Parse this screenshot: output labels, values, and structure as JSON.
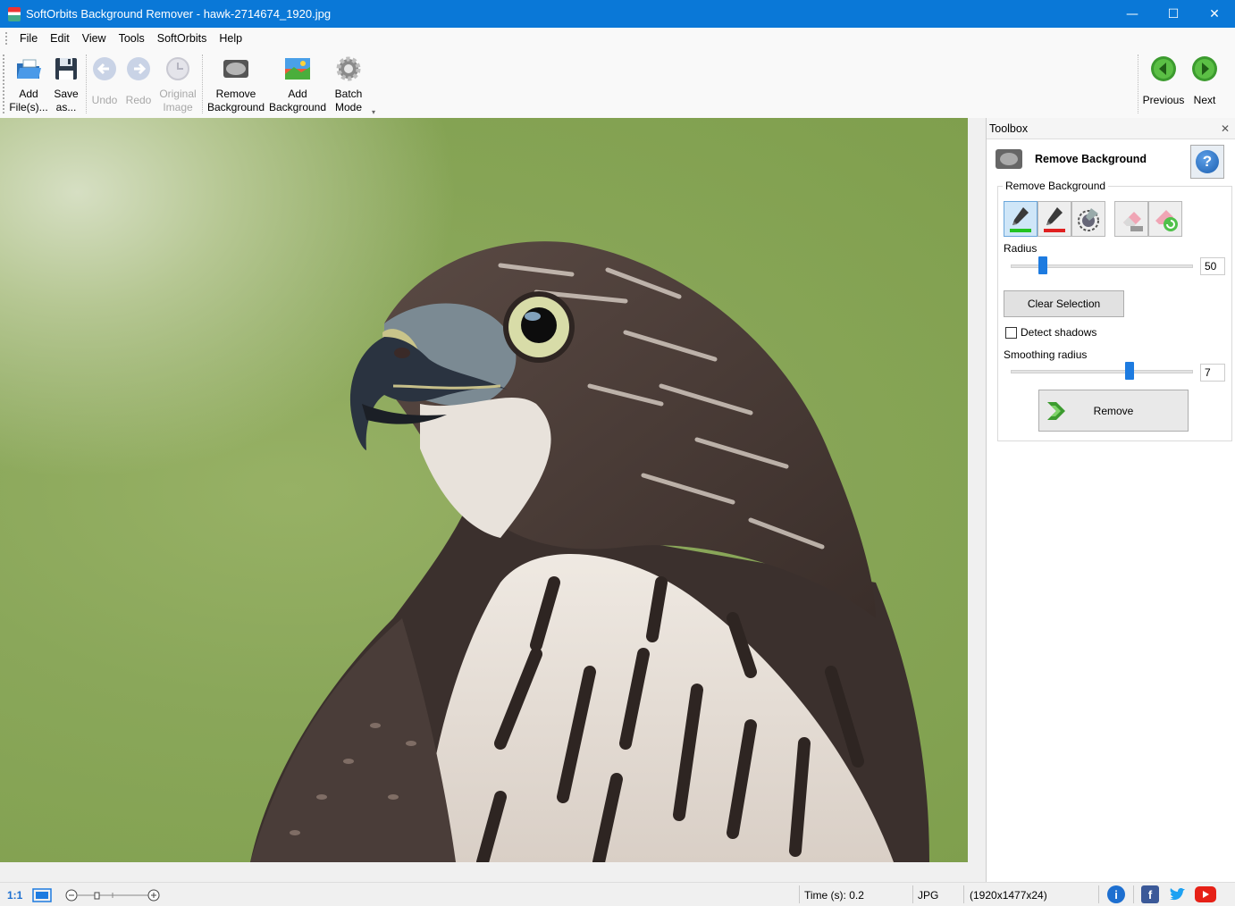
{
  "window": {
    "title": "SoftOrbits Background Remover - hawk-2714674_1920.jpg",
    "minimize": "—",
    "maximize": "☐",
    "close": "✕"
  },
  "menu": {
    "items": [
      "File",
      "Edit",
      "View",
      "Tools",
      "SoftOrbits",
      "Help"
    ]
  },
  "toolbar": {
    "add_files": [
      "Add",
      "File(s)..."
    ],
    "save_as": [
      "Save",
      "as..."
    ],
    "undo": "Undo",
    "redo": "Redo",
    "original_image": [
      "Original",
      "Image"
    ],
    "remove_background": [
      "Remove",
      "Background"
    ],
    "add_background": [
      "Add",
      "Background"
    ],
    "batch_mode": [
      "Batch",
      "Mode"
    ],
    "previous": "Previous",
    "next": "Next"
  },
  "toolbox": {
    "header": "Toolbox",
    "panel_title": "Remove Background",
    "help_glyph": "?",
    "group_label": "Remove Background",
    "radius_label": "Radius",
    "radius_value": "50",
    "clear_selection": "Clear Selection",
    "detect_shadows": "Detect shadows",
    "detect_shadows_checked": false,
    "smoothing_label": "Smoothing radius",
    "smoothing_value": "7",
    "remove_button": "Remove"
  },
  "status": {
    "zoom_label": "1:1",
    "time": "Time (s): 0.2",
    "format": "JPG",
    "dimensions": "(1920x1477x24)"
  },
  "colors": {
    "titlebar": "#0a78d7",
    "accent": "#1d7be0",
    "nav_green": "#3c9b2f"
  }
}
